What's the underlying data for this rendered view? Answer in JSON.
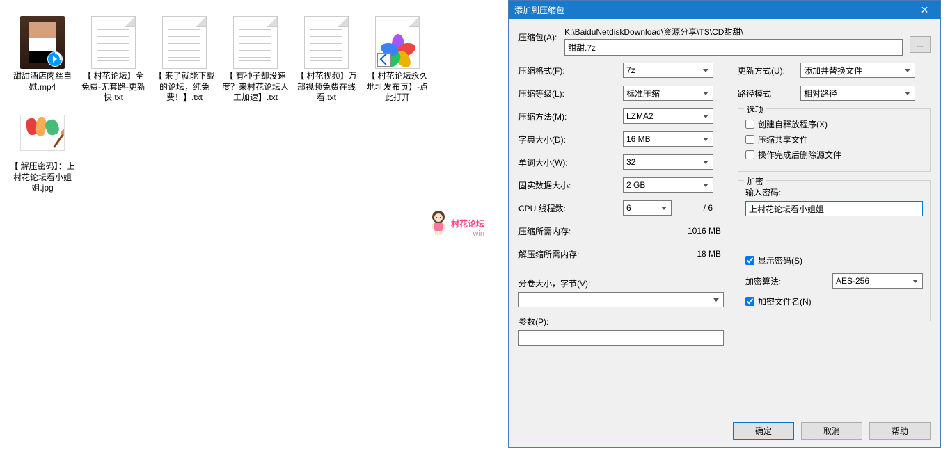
{
  "files": [
    {
      "name": "甜甜酒店肉丝自慰.mp4",
      "type": "video"
    },
    {
      "name": "【 村花论坛】全免费-无套路-更新快.txt",
      "type": "txt"
    },
    {
      "name": "【 来了就能下载的论坛，纯免费！】.txt",
      "type": "txt"
    },
    {
      "name": "【 有种子却没速度？来村花论坛人工加速】.txt",
      "type": "txt"
    },
    {
      "name": "【 村花视频】万部视频免费在线看.txt",
      "type": "txt"
    },
    {
      "name": "【 村花论坛永久地址发布页】-点此打开",
      "type": "browser"
    },
    {
      "name": "【 解压密码】：上村花论坛看小姐姐.jpg",
      "type": "jpg"
    }
  ],
  "watermark": {
    "text": "村花论坛",
    "sub": "win"
  },
  "dialog": {
    "title": "添加到压缩包",
    "archive_label": "压缩包(A):",
    "path": "K:\\BaiduNetdiskDownload\\资源分享\\TS\\CD甜甜\\",
    "archive_name": "甜甜.7z",
    "browse": "...",
    "left": {
      "format_label": "压缩格式(F):",
      "format": "7z",
      "level_label": "压缩等级(L):",
      "level": "标准压缩",
      "method_label": "压缩方法(M):",
      "method": "LZMA2",
      "dict_label": "字典大小(D):",
      "dict": "16 MB",
      "word_label": "单词大小(W):",
      "word": "32",
      "solid_label": "固实数据大小:",
      "solid": "2 GB",
      "cpu_label": "CPU 线程数:",
      "cpu": "6",
      "cpu_max": "/ 6",
      "mem_comp_label": "压缩所需内存:",
      "mem_comp": "1016 MB",
      "mem_decomp_label": "解压缩所需内存:",
      "mem_decomp": "18 MB",
      "volume_label": "分卷大小，字节(V):",
      "params_label": "参数(P):"
    },
    "right": {
      "update_label": "更新方式(U):",
      "update": "添加并替换文件",
      "pathmode_label": "路径模式",
      "pathmode": "相对路径",
      "options_legend": "选项",
      "sfx": "创建自释放程序(X)",
      "shared": "压缩共享文件",
      "delete": "操作完成后删除源文件",
      "encrypt_legend": "加密",
      "pwd_label": "输入密码:",
      "pwd_value": "上村花论坛看小姐姐",
      "show_pwd": "显示密码(S)",
      "algo_label": "加密算法:",
      "algo": "AES-256",
      "encrypt_names": "加密文件名(N)"
    },
    "buttons": {
      "ok": "确定",
      "cancel": "取消",
      "help": "帮助"
    }
  }
}
